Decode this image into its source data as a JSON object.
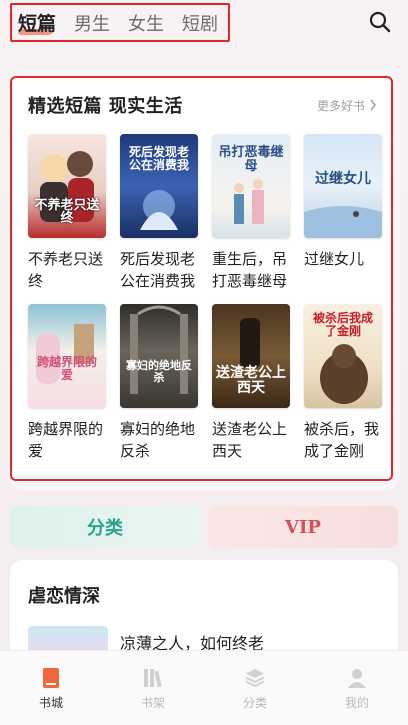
{
  "top_tabs": [
    {
      "label": "短篇",
      "active": true
    },
    {
      "label": "男生",
      "active": false
    },
    {
      "label": "女生",
      "active": false
    },
    {
      "label": "短剧",
      "active": false
    }
  ],
  "search_icon": "search-icon",
  "section": {
    "title": "精选短篇 现实生活",
    "more_label": "更多好书",
    "books": [
      {
        "title": "不养老只送终",
        "cover_text": "不养老只送终",
        "cover_color": "#f2e0d8"
      },
      {
        "title": "死后发现老公在消费我",
        "cover_text": "死后发现老公在消费我",
        "cover_color": "#2d4a8a"
      },
      {
        "title": "重生后，吊打恶毒继母",
        "cover_text": "吊打恶毒继母",
        "cover_color": "#dce8f0"
      },
      {
        "title": "过继女儿",
        "cover_text": "过继女儿",
        "cover_color": "#cfe3f3"
      },
      {
        "title": "跨越界限的爱",
        "cover_text": "跨越界限的爱",
        "cover_color": "#eaf1f6"
      },
      {
        "title": "寡妇的绝地反杀",
        "cover_text": "寡妇的绝地反杀",
        "cover_color": "#3e3a36"
      },
      {
        "title": "送渣老公上西天",
        "cover_text": "送渣老公上西天",
        "cover_color": "#5a4027"
      },
      {
        "title": "被杀后，我成了金刚",
        "cover_text": "被杀后我成了金刚",
        "cover_color": "#f4ead8"
      }
    ]
  },
  "category_button": "分类",
  "vip_button": "VIP",
  "section2": {
    "title": "虐恋情深",
    "preview_title": "凉薄之人，如何终老"
  },
  "bottom_nav": [
    {
      "label": "书城",
      "icon": "bookstore-icon",
      "active": true
    },
    {
      "label": "书架",
      "icon": "bookshelf-icon",
      "active": false
    },
    {
      "label": "分类",
      "icon": "category-icon",
      "active": false
    },
    {
      "label": "我的",
      "icon": "profile-icon",
      "active": false
    }
  ]
}
